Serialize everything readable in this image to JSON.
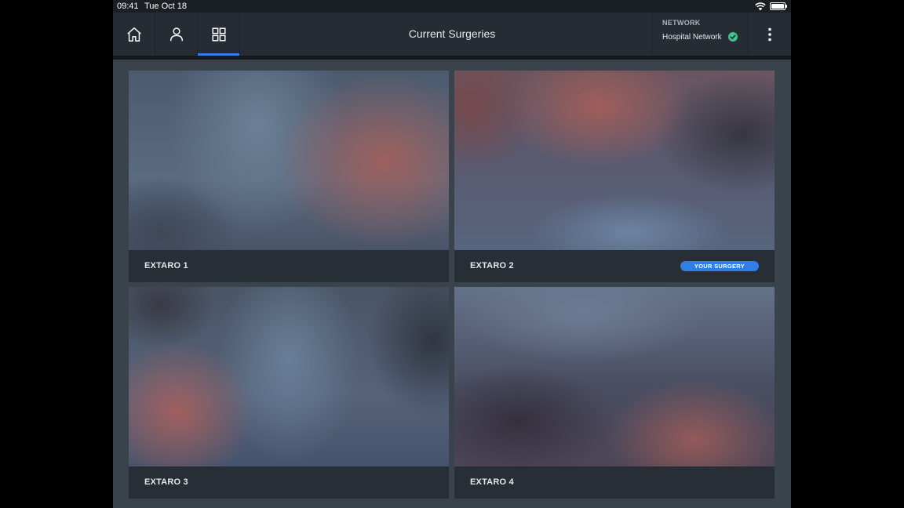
{
  "status_bar": {
    "time": "09:41",
    "date": "Tue Oct 18"
  },
  "nav": {
    "buttons": [
      {
        "icon": "home-icon",
        "active": false
      },
      {
        "icon": "person-icon",
        "active": false
      },
      {
        "icon": "grid-icon",
        "active": true
      }
    ],
    "title": "Current Surgeries",
    "network_label": "NETWORK",
    "network_value": "Hospital Network",
    "network_status": "connected"
  },
  "colors": {
    "accent": "#2f7fe6",
    "connected": "#3ec68e",
    "background": "#1e2329",
    "panel": "#3a424b"
  },
  "surgeries": [
    {
      "name": "EXTARO 1",
      "badge": ""
    },
    {
      "name": "EXTARO 2",
      "badge": "YOUR SURGERY"
    },
    {
      "name": "EXTARO 3",
      "badge": ""
    },
    {
      "name": "EXTARO 4",
      "badge": ""
    }
  ]
}
